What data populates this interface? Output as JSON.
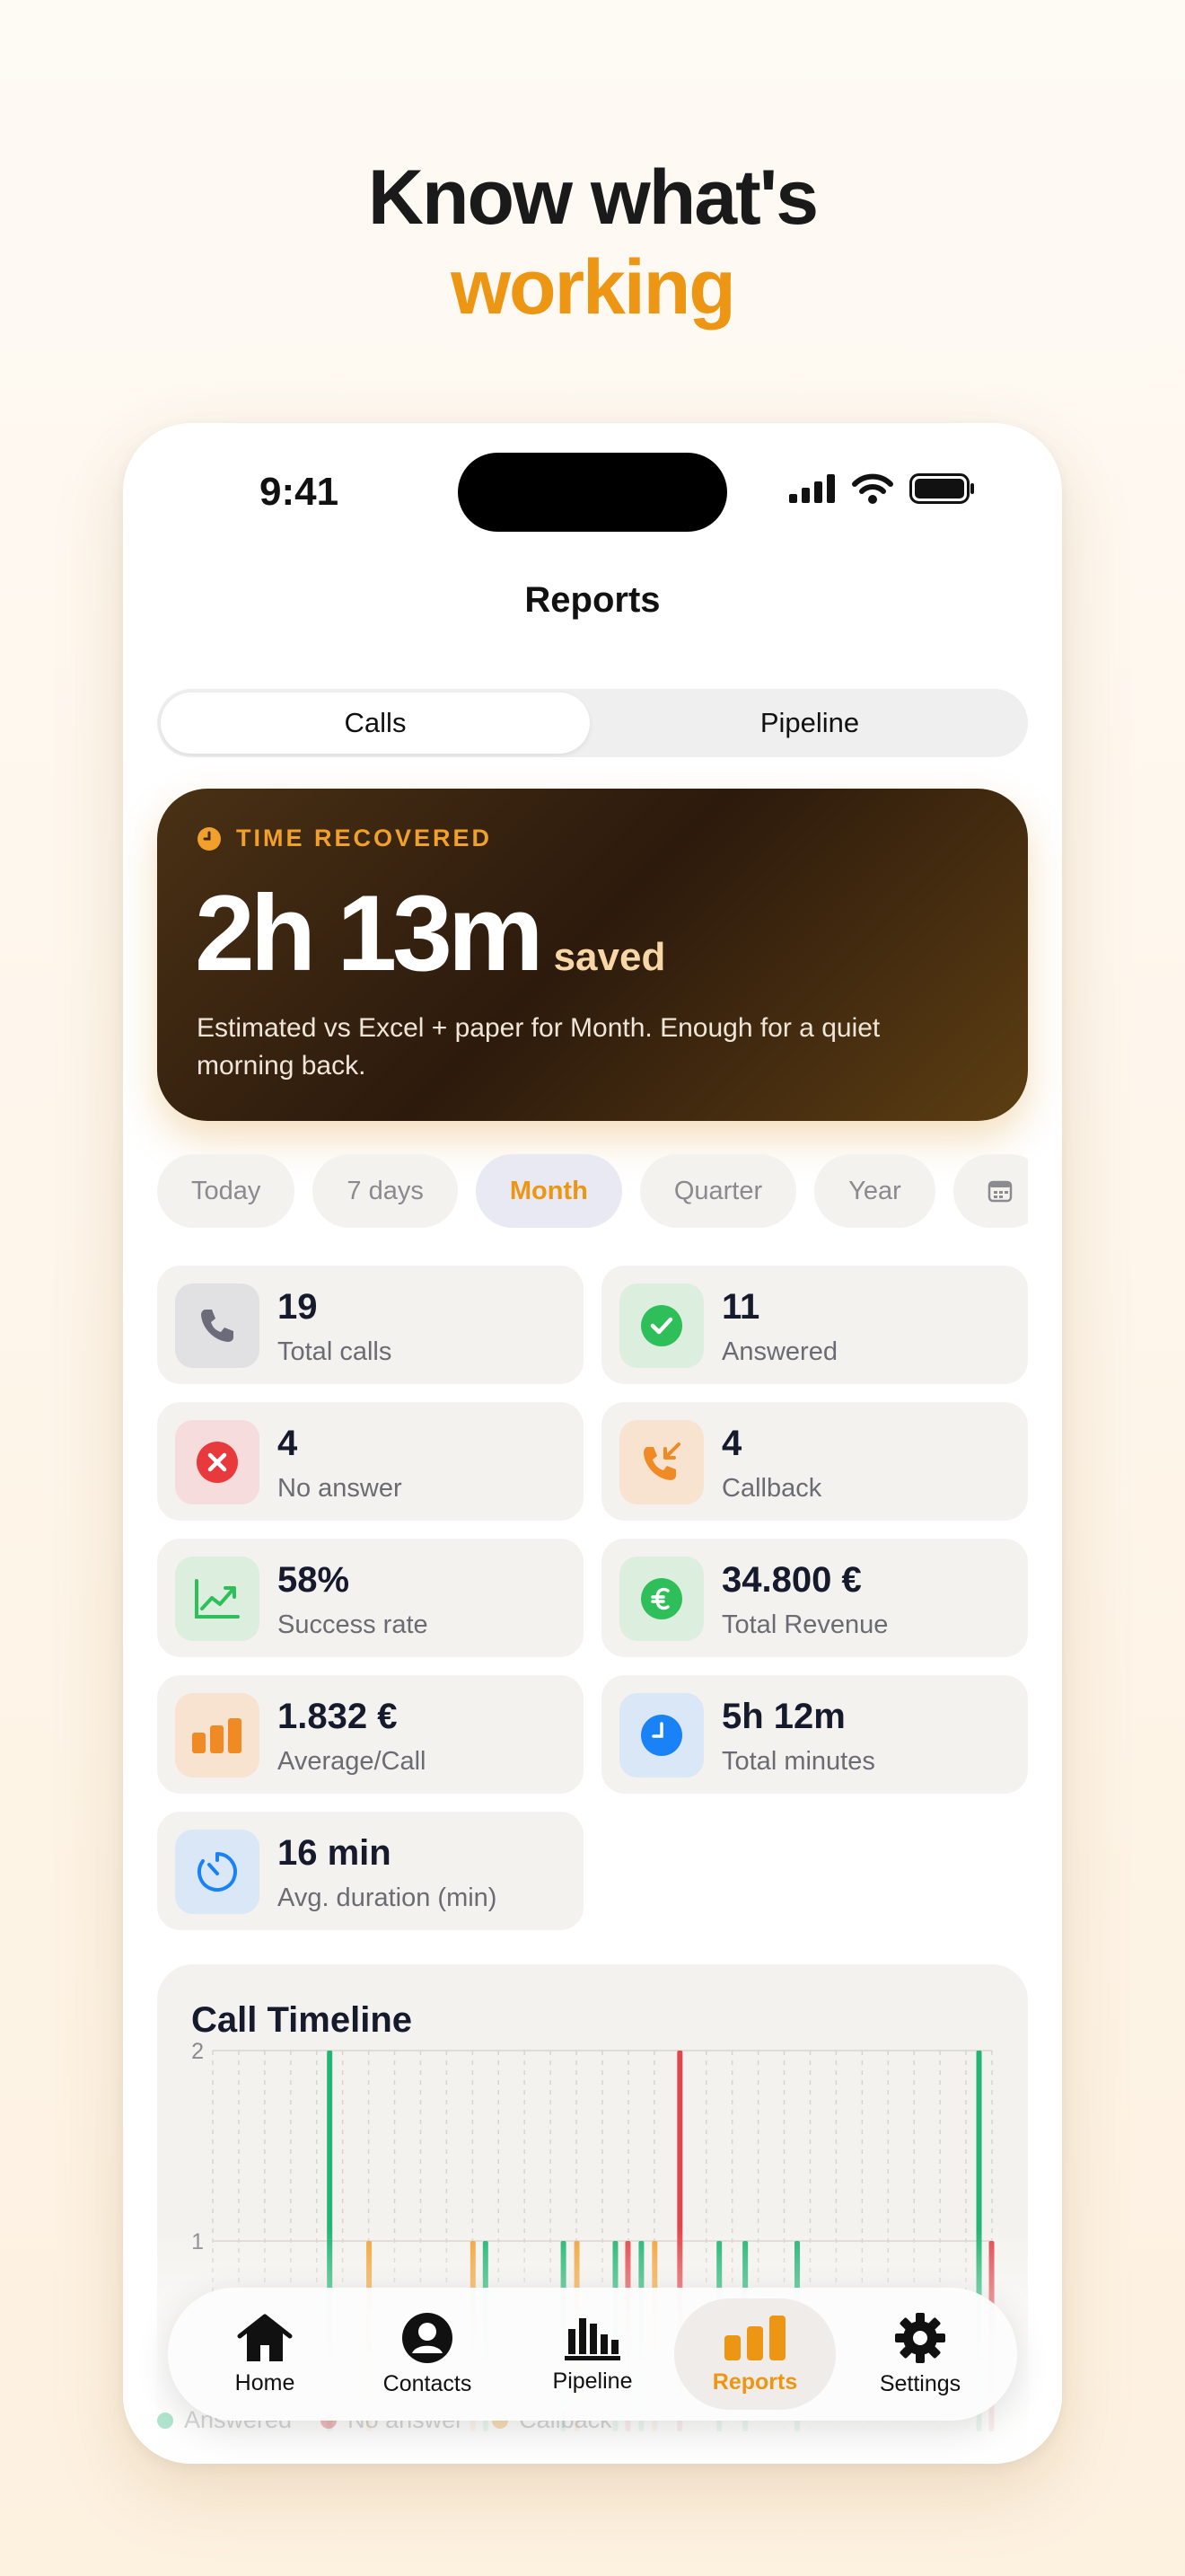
{
  "headline": {
    "line1": "Know what's",
    "line2": "working"
  },
  "status_bar": {
    "time": "9:41"
  },
  "nav": {
    "title": "Reports"
  },
  "segmented": {
    "calls": "Calls",
    "pipeline": "Pipeline"
  },
  "hero": {
    "label": "TIME RECOVERED",
    "value": "2h 13m",
    "suffix": "saved",
    "description": "Estimated vs Excel + paper for Month. Enough for a quiet morning back."
  },
  "periods": [
    "Today",
    "7 days",
    "Month",
    "Quarter",
    "Year"
  ],
  "active_period": "Month",
  "stats": [
    {
      "value": "19",
      "label": "Total calls",
      "icon": "phone-icon"
    },
    {
      "value": "11",
      "label": "Answered",
      "icon": "check-circle-icon"
    },
    {
      "value": "4",
      "label": "No answer",
      "icon": "x-circle-icon"
    },
    {
      "value": "4",
      "label": "Callback",
      "icon": "incoming-call-icon"
    },
    {
      "value": "58%",
      "label": "Success rate",
      "icon": "trend-up-icon"
    },
    {
      "value": "34.800 €",
      "label": "Total Revenue",
      "icon": "euro-icon"
    },
    {
      "value": "1.832 €",
      "label": "Average/Call",
      "icon": "bar-chart-icon"
    },
    {
      "value": "5h 12m",
      "label": "Total minutes",
      "icon": "clock-icon"
    },
    {
      "value": "16 min",
      "label": "Avg. duration (min)",
      "icon": "timer-icon"
    }
  ],
  "timeline": {
    "title": "Call Timeline"
  },
  "colors": {
    "accent": "#ec9613",
    "answered": "#22b573",
    "no_answer": "#e0474c",
    "callback": "#f0a53a"
  },
  "chart_data": {
    "type": "bar",
    "title": "Call Timeline",
    "ylim": [
      0,
      2
    ],
    "yticks": [
      "2",
      "1"
    ],
    "grid": true,
    "legend_position": "bottom",
    "x": [
      1,
      2,
      3,
      4,
      5,
      6,
      7,
      8,
      9,
      10,
      11,
      12,
      13,
      14,
      15,
      16,
      17,
      18,
      19,
      20,
      21,
      22,
      23,
      24,
      25,
      26,
      27,
      28,
      29,
      30
    ],
    "series": [
      {
        "name": "Answered",
        "color": "#22b573",
        "values": [
          0,
          0,
          0,
          0,
          2,
          0,
          0,
          0,
          0,
          0,
          1,
          0,
          0,
          1,
          0,
          1,
          1,
          0,
          0,
          1,
          1,
          0,
          1,
          0,
          0,
          0,
          0,
          0,
          0,
          2
        ]
      },
      {
        "name": "No answer",
        "color": "#e0474c",
        "values": [
          0,
          0,
          0,
          0,
          0,
          0,
          0,
          0,
          0,
          0,
          0,
          0,
          0,
          0,
          0,
          1,
          0,
          2,
          0,
          0,
          0,
          0,
          0,
          0,
          0,
          0,
          0,
          0,
          0,
          1
        ]
      },
      {
        "name": "Callback",
        "color": "#f0a53a",
        "values": [
          0,
          0,
          0,
          0,
          0,
          0,
          1,
          0,
          0,
          0,
          1,
          0,
          0,
          0,
          1,
          0,
          0,
          1,
          0,
          0,
          0,
          0,
          0,
          0,
          0,
          0,
          0,
          0,
          0,
          0
        ]
      }
    ]
  },
  "tabs": [
    {
      "label": "Home",
      "icon": "home-icon"
    },
    {
      "label": "Contacts",
      "icon": "person-circle-icon"
    },
    {
      "label": "Pipeline",
      "icon": "bar-chart-icon"
    },
    {
      "label": "Reports",
      "icon": "reports-icon"
    },
    {
      "label": "Settings",
      "icon": "gear-icon"
    }
  ],
  "active_tab": "Reports"
}
